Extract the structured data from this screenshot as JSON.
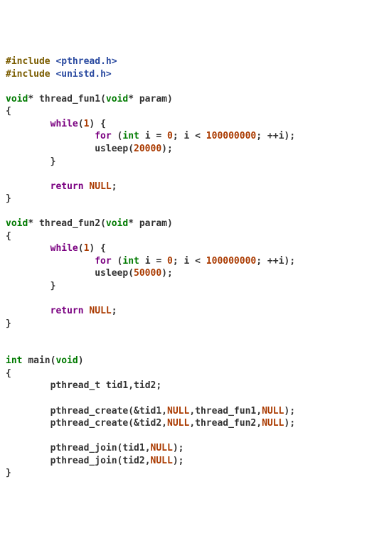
{
  "code": {
    "tokens": [
      [
        {
          "c": "pp",
          "t": "#include"
        },
        {
          "c": "op",
          "t": " "
        },
        {
          "c": "hdr",
          "t": "<pthread.h>"
        }
      ],
      [
        {
          "c": "pp",
          "t": "#include"
        },
        {
          "c": "op",
          "t": " "
        },
        {
          "c": "hdr",
          "t": "<unistd.h>"
        }
      ],
      [],
      [
        {
          "c": "type",
          "t": "void"
        },
        {
          "c": "op",
          "t": "* "
        },
        {
          "c": "fn",
          "t": "thread_fun1"
        },
        {
          "c": "op",
          "t": "("
        },
        {
          "c": "type",
          "t": "void"
        },
        {
          "c": "op",
          "t": "* "
        },
        {
          "c": "id",
          "t": "param"
        },
        {
          "c": "op",
          "t": ")"
        }
      ],
      [
        {
          "c": "op",
          "t": "{"
        }
      ],
      [
        {
          "c": "op",
          "t": "        "
        },
        {
          "c": "kw",
          "t": "while"
        },
        {
          "c": "op",
          "t": "("
        },
        {
          "c": "num",
          "t": "1"
        },
        {
          "c": "op",
          "t": ") {"
        }
      ],
      [
        {
          "c": "op",
          "t": "                "
        },
        {
          "c": "kw",
          "t": "for"
        },
        {
          "c": "op",
          "t": " ("
        },
        {
          "c": "type",
          "t": "int"
        },
        {
          "c": "op",
          "t": " "
        },
        {
          "c": "id",
          "t": "i"
        },
        {
          "c": "op",
          "t": " = "
        },
        {
          "c": "num",
          "t": "0"
        },
        {
          "c": "op",
          "t": "; "
        },
        {
          "c": "id",
          "t": "i"
        },
        {
          "c": "op",
          "t": " < "
        },
        {
          "c": "num",
          "t": "100000000"
        },
        {
          "c": "op",
          "t": "; ++"
        },
        {
          "c": "id",
          "t": "i"
        },
        {
          "c": "op",
          "t": ");"
        }
      ],
      [
        {
          "c": "op",
          "t": "                "
        },
        {
          "c": "fn",
          "t": "usleep"
        },
        {
          "c": "op",
          "t": "("
        },
        {
          "c": "num",
          "t": "20000"
        },
        {
          "c": "op",
          "t": ");"
        }
      ],
      [
        {
          "c": "op",
          "t": "        }"
        }
      ],
      [],
      [
        {
          "c": "op",
          "t": "        "
        },
        {
          "c": "kw",
          "t": "return"
        },
        {
          "c": "op",
          "t": " "
        },
        {
          "c": "num",
          "t": "NULL"
        },
        {
          "c": "op",
          "t": ";"
        }
      ],
      [
        {
          "c": "op",
          "t": "}"
        }
      ],
      [],
      [
        {
          "c": "type",
          "t": "void"
        },
        {
          "c": "op",
          "t": "* "
        },
        {
          "c": "fn",
          "t": "thread_fun2"
        },
        {
          "c": "op",
          "t": "("
        },
        {
          "c": "type",
          "t": "void"
        },
        {
          "c": "op",
          "t": "* "
        },
        {
          "c": "id",
          "t": "param"
        },
        {
          "c": "op",
          "t": ")"
        }
      ],
      [
        {
          "c": "op",
          "t": "{"
        }
      ],
      [
        {
          "c": "op",
          "t": "        "
        },
        {
          "c": "kw",
          "t": "while"
        },
        {
          "c": "op",
          "t": "("
        },
        {
          "c": "num",
          "t": "1"
        },
        {
          "c": "op",
          "t": ") {"
        }
      ],
      [
        {
          "c": "op",
          "t": "                "
        },
        {
          "c": "kw",
          "t": "for"
        },
        {
          "c": "op",
          "t": " ("
        },
        {
          "c": "type",
          "t": "int"
        },
        {
          "c": "op",
          "t": " "
        },
        {
          "c": "id",
          "t": "i"
        },
        {
          "c": "op",
          "t": " = "
        },
        {
          "c": "num",
          "t": "0"
        },
        {
          "c": "op",
          "t": "; "
        },
        {
          "c": "id",
          "t": "i"
        },
        {
          "c": "op",
          "t": " < "
        },
        {
          "c": "num",
          "t": "100000000"
        },
        {
          "c": "op",
          "t": "; ++"
        },
        {
          "c": "id",
          "t": "i"
        },
        {
          "c": "op",
          "t": ");"
        }
      ],
      [
        {
          "c": "op",
          "t": "                "
        },
        {
          "c": "fn",
          "t": "usleep"
        },
        {
          "c": "op",
          "t": "("
        },
        {
          "c": "num",
          "t": "50000"
        },
        {
          "c": "op",
          "t": ");"
        }
      ],
      [
        {
          "c": "op",
          "t": "        }"
        }
      ],
      [],
      [
        {
          "c": "op",
          "t": "        "
        },
        {
          "c": "kw",
          "t": "return"
        },
        {
          "c": "op",
          "t": " "
        },
        {
          "c": "num",
          "t": "NULL"
        },
        {
          "c": "op",
          "t": ";"
        }
      ],
      [
        {
          "c": "op",
          "t": "}"
        }
      ],
      [],
      [],
      [
        {
          "c": "type",
          "t": "int"
        },
        {
          "c": "op",
          "t": " "
        },
        {
          "c": "fn",
          "t": "main"
        },
        {
          "c": "op",
          "t": "("
        },
        {
          "c": "type",
          "t": "void"
        },
        {
          "c": "op",
          "t": ")"
        }
      ],
      [
        {
          "c": "op",
          "t": "{"
        }
      ],
      [
        {
          "c": "op",
          "t": "        "
        },
        {
          "c": "id",
          "t": "pthread_t"
        },
        {
          "c": "op",
          "t": " "
        },
        {
          "c": "id",
          "t": "tid1"
        },
        {
          "c": "op",
          "t": ","
        },
        {
          "c": "id",
          "t": "tid2"
        },
        {
          "c": "op",
          "t": ";"
        }
      ],
      [],
      [
        {
          "c": "op",
          "t": "        "
        },
        {
          "c": "fn",
          "t": "pthread_create"
        },
        {
          "c": "op",
          "t": "(&"
        },
        {
          "c": "id",
          "t": "tid1"
        },
        {
          "c": "op",
          "t": ","
        },
        {
          "c": "num",
          "t": "NULL"
        },
        {
          "c": "op",
          "t": ","
        },
        {
          "c": "id",
          "t": "thread_fun1"
        },
        {
          "c": "op",
          "t": ","
        },
        {
          "c": "num",
          "t": "NULL"
        },
        {
          "c": "op",
          "t": ");"
        }
      ],
      [
        {
          "c": "op",
          "t": "        "
        },
        {
          "c": "fn",
          "t": "pthread_create"
        },
        {
          "c": "op",
          "t": "(&"
        },
        {
          "c": "id",
          "t": "tid2"
        },
        {
          "c": "op",
          "t": ","
        },
        {
          "c": "num",
          "t": "NULL"
        },
        {
          "c": "op",
          "t": ","
        },
        {
          "c": "id",
          "t": "thread_fun2"
        },
        {
          "c": "op",
          "t": ","
        },
        {
          "c": "num",
          "t": "NULL"
        },
        {
          "c": "op",
          "t": ");"
        }
      ],
      [],
      [
        {
          "c": "op",
          "t": "        "
        },
        {
          "c": "fn",
          "t": "pthread_join"
        },
        {
          "c": "op",
          "t": "("
        },
        {
          "c": "id",
          "t": "tid1"
        },
        {
          "c": "op",
          "t": ","
        },
        {
          "c": "num",
          "t": "NULL"
        },
        {
          "c": "op",
          "t": ");"
        }
      ],
      [
        {
          "c": "op",
          "t": "        "
        },
        {
          "c": "fn",
          "t": "pthread_join"
        },
        {
          "c": "op",
          "t": "("
        },
        {
          "c": "id",
          "t": "tid2"
        },
        {
          "c": "op",
          "t": ","
        },
        {
          "c": "num",
          "t": "NULL"
        },
        {
          "c": "op",
          "t": ");"
        }
      ],
      [
        {
          "c": "op",
          "t": "}"
        }
      ]
    ]
  }
}
